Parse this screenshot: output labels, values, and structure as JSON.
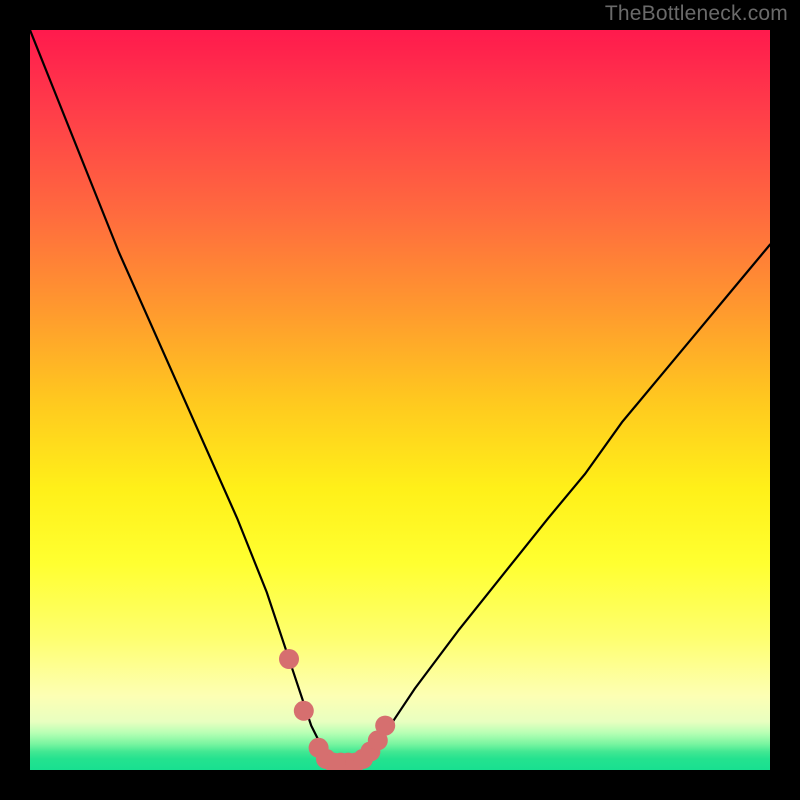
{
  "watermark": "TheBottleneck.com",
  "chart_data": {
    "type": "line",
    "title": "",
    "xlabel": "",
    "ylabel": "",
    "xlim": [
      0,
      100
    ],
    "ylim": [
      0,
      100
    ],
    "x": [
      0,
      4,
      8,
      12,
      16,
      20,
      24,
      28,
      30,
      32,
      34,
      35,
      36,
      37,
      38,
      39,
      40,
      41,
      42,
      43,
      44,
      45,
      46,
      47,
      48,
      50,
      52,
      55,
      58,
      62,
      66,
      70,
      75,
      80,
      85,
      90,
      95,
      100
    ],
    "values": [
      100,
      90,
      80,
      70,
      61,
      52,
      43,
      34,
      29,
      24,
      18,
      15,
      12,
      9,
      6,
      4,
      2,
      1,
      0.5,
      0.5,
      0.5,
      1,
      2,
      3,
      5,
      8,
      11,
      15,
      19,
      24,
      29,
      34,
      40,
      47,
      53,
      59,
      65,
      71
    ],
    "markers": {
      "x": [
        35,
        37,
        39,
        40,
        41,
        42,
        43,
        44,
        45,
        46,
        47,
        48
      ],
      "y": [
        15,
        8,
        3,
        1.5,
        1,
        1,
        1,
        1,
        1.5,
        2.5,
        4,
        6
      ]
    },
    "gradient_stops": [
      {
        "pct": 0,
        "color": "#ff1a4d"
      },
      {
        "pct": 10,
        "color": "#ff3a4a"
      },
      {
        "pct": 25,
        "color": "#ff6b3e"
      },
      {
        "pct": 38,
        "color": "#ff9a2e"
      },
      {
        "pct": 50,
        "color": "#ffc81f"
      },
      {
        "pct": 62,
        "color": "#fff019"
      },
      {
        "pct": 72,
        "color": "#ffff30"
      },
      {
        "pct": 82,
        "color": "#feff6e"
      },
      {
        "pct": 90,
        "color": "#fdffb4"
      },
      {
        "pct": 93.5,
        "color": "#e8ffc0"
      },
      {
        "pct": 95,
        "color": "#b7ffb4"
      },
      {
        "pct": 96.5,
        "color": "#78f5a0"
      },
      {
        "pct": 97.5,
        "color": "#43e893"
      },
      {
        "pct": 98.5,
        "color": "#24e28f"
      },
      {
        "pct": 100,
        "color": "#18e090"
      }
    ],
    "line_color": "#000000",
    "marker_color": "#d66f6f"
  }
}
